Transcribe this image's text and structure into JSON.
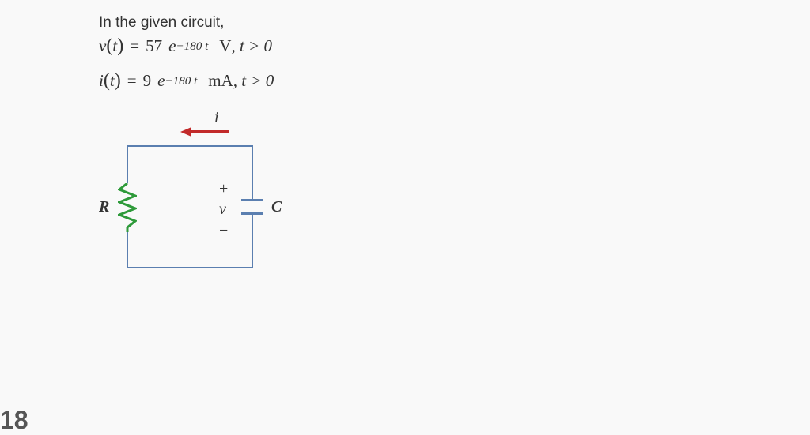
{
  "intro": "In the given circuit,",
  "eq1": {
    "lhs_var": "v",
    "lhs_arg": "t",
    "coef": "57",
    "expbase": "e",
    "exponent": "−180 t",
    "unit": "V",
    "cond": ", t > 0"
  },
  "eq2": {
    "lhs_var": "i",
    "lhs_arg": "t",
    "coef": "9",
    "expbase": "e",
    "exponent": "−180 t",
    "unit": "mA",
    "cond": ", t > 0"
  },
  "diagram": {
    "i": "i",
    "R": "R",
    "C": "C",
    "v": "v",
    "plus": "+",
    "minus": "−"
  },
  "pagenum": "18"
}
